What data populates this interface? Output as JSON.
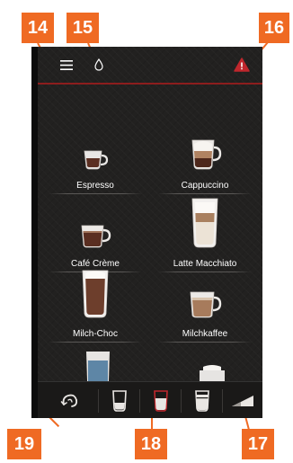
{
  "callouts": {
    "c14": "14",
    "c15": "15",
    "c16": "16",
    "c17": "17",
    "c18": "18",
    "c19": "19"
  },
  "topbar": {
    "menu_icon": "hamburger-menu-icon",
    "water_icon": "water-drop-icon",
    "warning_icon": "warning-triangle-icon"
  },
  "drinks": [
    {
      "label": "Espresso"
    },
    {
      "label": "Cappuccino"
    },
    {
      "label": "Café Crème"
    },
    {
      "label": "Latte Macchiato"
    },
    {
      "label": "Milch-Choc"
    },
    {
      "label": "Milchkaffee"
    }
  ],
  "bottombar": {
    "items": [
      {
        "icon": "rinse-cycle-icon"
      },
      {
        "icon": "small-cup-size-icon"
      },
      {
        "icon": "medium-cup-size-icon",
        "selected": true
      },
      {
        "icon": "large-cup-size-icon"
      },
      {
        "icon": "strength-wedge-icon"
      }
    ]
  },
  "colors": {
    "callout": "#ef6a23",
    "screen_bg": "#222120",
    "accent_red": "#c0272d"
  }
}
